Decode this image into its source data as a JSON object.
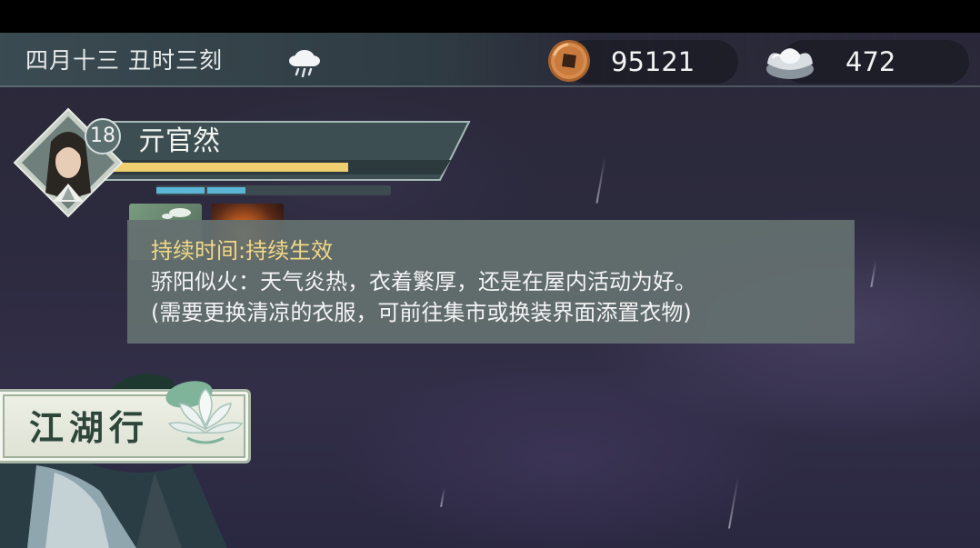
{
  "hud": {
    "date_time": "四月十三  丑时三刻",
    "weather_icon": "rain-cloud-icon",
    "copper_coins": "95121",
    "silver_ingots": "472"
  },
  "character": {
    "level": "18",
    "name": "亓官然",
    "hp_fraction": 0.7,
    "mp_fraction": 0.38
  },
  "buffs": [
    {
      "icon": "weather-buff-icon"
    },
    {
      "icon": "fire-buff-icon"
    }
  ],
  "tooltip": {
    "duration": "持续时间:持续生效",
    "description": "骄阳似火：天气炎热，衣着繁厚，还是在屋内活动为好。",
    "hint": "(需要更换清凉的衣服，可前往集市或换装界面添置衣物)"
  },
  "menu": {
    "jianghu_label": "江湖行"
  },
  "colors": {
    "tooltip_title": "#f1d887",
    "hp_bar": "#f0cf6f",
    "mp_bar": "#5bb6d6"
  }
}
